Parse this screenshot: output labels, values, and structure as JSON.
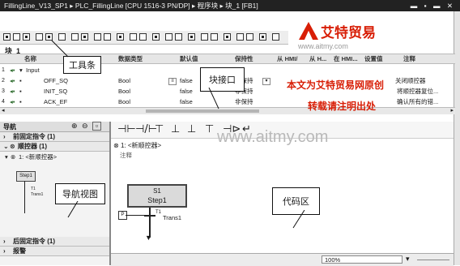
{
  "window": {
    "title": "FillingLine_V13_SP1 ▸ PLC_FillingLine [CPU 1516-3 PN/DP] ▸ 程序块 ▸ 块_1 [FB1]",
    "controls": "▬ ▪ ▬ ✕"
  },
  "block": {
    "name": "块_1"
  },
  "interface": {
    "columns": [
      "名称",
      "数据类型",
      "默认值",
      "保持性",
      "从 HMI/",
      "从 H...",
      "在 HMI...",
      "设置值",
      "注释"
    ],
    "rows": [
      {
        "name": "Input",
        "type": "",
        "default": "",
        "retain": "",
        "comment": ""
      },
      {
        "name": "OFF_SQ",
        "type": "Bool",
        "default": "false",
        "retain": "非保持",
        "comment": "关闭顺控器"
      },
      {
        "name": "INIT_SQ",
        "type": "Bool",
        "default": "false",
        "retain": "非保持",
        "comment": "将顺控器复位..."
      },
      {
        "name": "ACK_EF",
        "type": "Bool",
        "default": "false",
        "retain": "非保持",
        "comment": "确认所有的错..."
      }
    ]
  },
  "navigation": {
    "header": "导航",
    "sections": [
      {
        "label": "前固定指令 (1)"
      },
      {
        "label": "顺控器 (1)"
      },
      {
        "label": "后固定指令 (1)"
      },
      {
        "label": "报警"
      }
    ],
    "seq_item": "1: <新顺控器>",
    "thumb_step": "Step1",
    "thumb_trans": "Trans1",
    "thumb_trans_num": "T1"
  },
  "editor": {
    "seq_title": "1: <新顺控器>",
    "comment_label": "注释",
    "step_number": "S1",
    "step_name": "Step1",
    "trans_number": "T1",
    "trans_name": "Trans1",
    "instructions": [
      "⊣⊢",
      "⊣/⊢",
      "⊤",
      "⊥",
      "⊥",
      "⊤",
      "⊣⊳",
      "↵"
    ]
  },
  "status": {
    "zoom": "100%"
  },
  "annotations": {
    "toolbar": "工具条",
    "interface": "块接口",
    "nav_view": "导航视图",
    "code_area": "代码区"
  },
  "watermark": {
    "brand": "艾特贸易",
    "url": "www.aitmy.com",
    "line1": "本文为艾特贸易网原创",
    "line2": "转载请注明出处",
    "url2": "www.aitmy.com"
  },
  "colors": {
    "titlebar": "#222222",
    "callout_border": "#111111",
    "watermark_red": "#d81e06",
    "watermark_gray": "#9a9a9a"
  }
}
